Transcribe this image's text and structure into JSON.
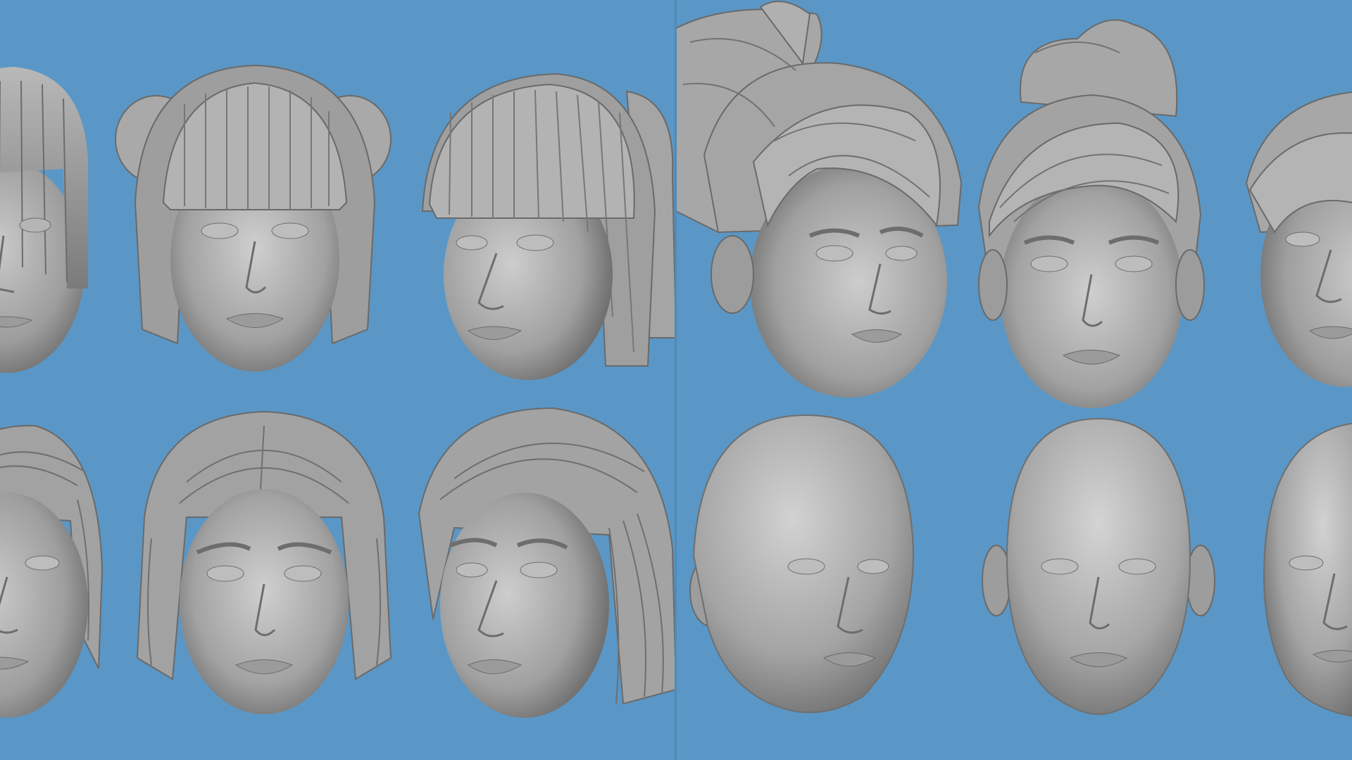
{
  "scene": {
    "background_color": "#5a97c6",
    "sculpt_color": "#a7a7a7",
    "panels": [
      {
        "name": "left-panel",
        "rows": [
          {
            "row": "top",
            "heads": [
              {
                "hair": "blunt-bangs-bob",
                "view": "three-quarter-cropped"
              },
              {
                "hair": "twin-buns-blunt-bangs",
                "view": "front"
              },
              {
                "hair": "blunt-bangs-bob-side-bun",
                "view": "three-quarter"
              }
            ]
          },
          {
            "row": "bottom",
            "heads": [
              {
                "hair": "slicked-back-shoulder",
                "view": "three-quarter-cropped"
              },
              {
                "hair": "slicked-back-shoulder",
                "view": "front"
              },
              {
                "hair": "slicked-back-long",
                "view": "three-quarter"
              }
            ]
          }
        ]
      },
      {
        "name": "right-panel",
        "rows": [
          {
            "row": "top",
            "heads": [
              {
                "hair": "high-ponytail-swept-fringe",
                "view": "three-quarter"
              },
              {
                "hair": "high-ponytail-swept-fringe",
                "view": "front"
              },
              {
                "hair": "swept-fringe",
                "view": "three-quarter-cropped"
              }
            ]
          },
          {
            "row": "bottom",
            "heads": [
              {
                "hair": "bald",
                "view": "three-quarter"
              },
              {
                "hair": "bald",
                "view": "front"
              },
              {
                "hair": "bald",
                "view": "three-quarter-cropped"
              }
            ]
          }
        ]
      }
    ]
  }
}
